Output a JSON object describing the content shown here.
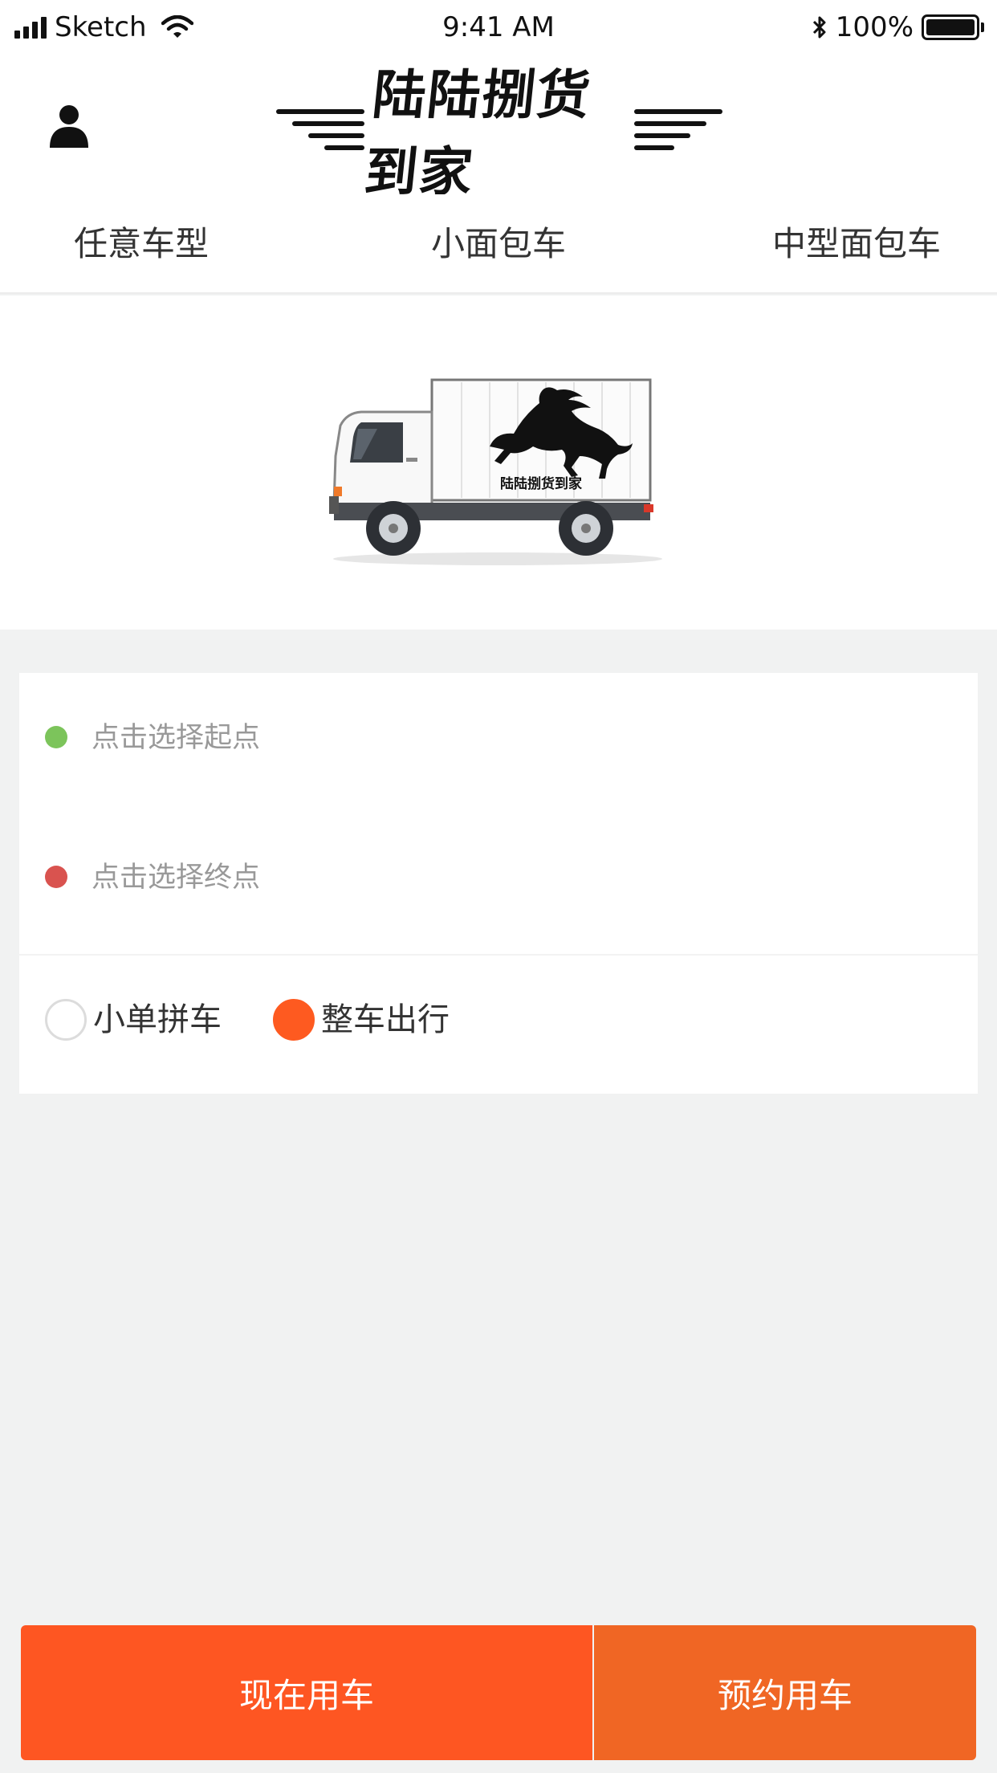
{
  "status_bar": {
    "carrier": "Sketch",
    "time": "9:41 AM",
    "battery": "100%",
    "icons": [
      "signal-icon",
      "wifi-icon",
      "bluetooth-icon",
      "battery-icon"
    ]
  },
  "header": {
    "logo_text": "陆陆捌货到家",
    "profile_icon": "person-icon"
  },
  "vehicle_tabs": [
    {
      "label": "任意车型"
    },
    {
      "label": "小面包车"
    },
    {
      "label": "中型面包车"
    }
  ],
  "truck": {
    "box_label": "陆陆捌货到家"
  },
  "address": {
    "start_placeholder": "点击选择起点",
    "end_placeholder": "点击选择终点",
    "start_dot_color": "#7cc45b",
    "end_dot_color": "#d9534f"
  },
  "ride_options": {
    "pool_label": "小单拼车",
    "whole_label": "整车出行",
    "selected": "整车出行"
  },
  "actions": {
    "now_label": "现在用车",
    "book_label": "预约用车"
  },
  "colors": {
    "accent": "#fe5622",
    "accent_secondary": "#f06624",
    "background": "#f1f2f2"
  }
}
